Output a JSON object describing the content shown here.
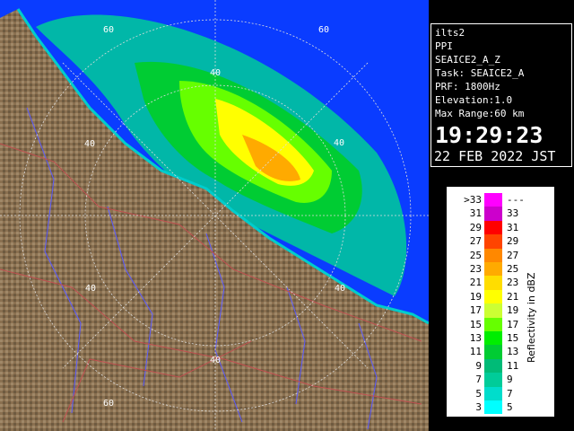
{
  "info": {
    "site": "ilts2",
    "mode": "PPI",
    "product": "SEAICE2_A_Z",
    "task": "Task: SEAICE2_A",
    "prf": "PRF: 1800Hz",
    "elevation": "Elevation:1.0",
    "max_range": "Max Range:60 km",
    "time": "19:29:23",
    "date": "22 FEB 2022 JST"
  },
  "map": {
    "range_ring_labels": [
      "60",
      "60",
      "40",
      "40",
      "40",
      "40",
      "40",
      "40",
      "60"
    ]
  },
  "legend": {
    "title": "Reflectivity in dBZ",
    "rows": [
      {
        "low": ">33",
        "high": "---",
        "color": "#ff00ff"
      },
      {
        "low": "31",
        "high": "33",
        "color": "#cc00cc"
      },
      {
        "low": "29",
        "high": "31",
        "color": "#ff0000"
      },
      {
        "low": "27",
        "high": "29",
        "color": "#ff4400"
      },
      {
        "low": "25",
        "high": "27",
        "color": "#ff8800"
      },
      {
        "low": "23",
        "high": "25",
        "color": "#ffaa00"
      },
      {
        "low": "21",
        "high": "23",
        "color": "#ffdd00"
      },
      {
        "low": "19",
        "high": "21",
        "color": "#ffff00"
      },
      {
        "low": "17",
        "high": "19",
        "color": "#ccff33"
      },
      {
        "low": "15",
        "high": "17",
        "color": "#66ff00"
      },
      {
        "low": "13",
        "high": "15",
        "color": "#00ee00"
      },
      {
        "low": "11",
        "high": "13",
        "color": "#00cc33"
      },
      {
        "low": "9",
        "high": "11",
        "color": "#00bb77"
      },
      {
        "low": "7",
        "high": "9",
        "color": "#00cc99"
      },
      {
        "low": "5",
        "high": "7",
        "color": "#00ddcc"
      },
      {
        "low": "3",
        "high": "5",
        "color": "#00ffff"
      }
    ]
  },
  "colors": {
    "sea": "#0a3cff",
    "land": "#8a7050",
    "rings": "#dddddd",
    "rivers": "#5a5aff",
    "boundaries": "#c05050"
  }
}
